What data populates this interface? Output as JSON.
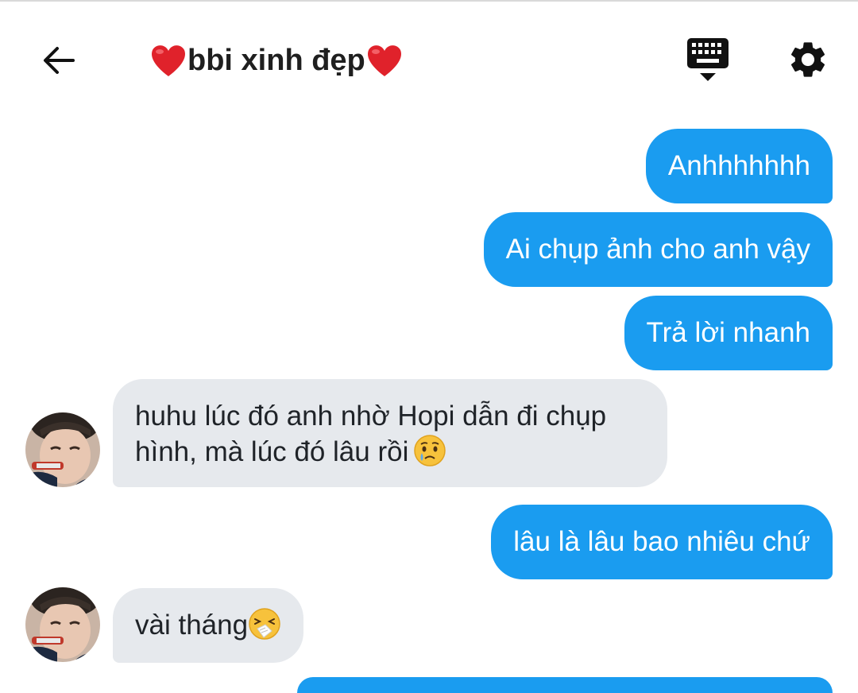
{
  "header": {
    "title": "bbi xinh đẹp",
    "back_icon": "arrow-left-icon",
    "keyboard_icon": "keyboard-icon",
    "settings_icon": "gear-icon"
  },
  "messages": [
    {
      "direction": "out",
      "text": "Anhhhhhhh"
    },
    {
      "direction": "out",
      "text": "Ai chụp ảnh cho anh vậy"
    },
    {
      "direction": "out",
      "text": "Trả lời nhanh"
    },
    {
      "direction": "in",
      "line1": "huhu lúc đó anh nhờ Hopi dẫn đi chụp",
      "line2": "hình, mà lúc đó lâu rồi",
      "emoji": "crying-face"
    },
    {
      "direction": "out",
      "text": "lâu là lâu bao nhiêu chứ"
    },
    {
      "direction": "in",
      "text": "vài tháng",
      "emoji": "sneezing-face"
    }
  ],
  "colors": {
    "outgoing_bubble": "#1a9cf0",
    "incoming_bubble": "#e6e9ed",
    "heart": "#e0222b"
  }
}
